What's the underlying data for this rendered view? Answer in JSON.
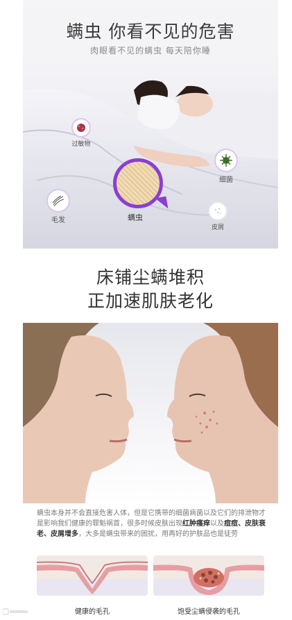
{
  "panel1": {
    "title": "螨虫 你看不见的危害",
    "subtitle": "肉眼看不见的螨虫 每天陪你睡",
    "callouts": {
      "allergen": "过敏物",
      "bacteria": "细菌",
      "hair": "毛发",
      "dandruff": "皮屑",
      "mite": "螨虫"
    }
  },
  "panel2": {
    "title_line1": "床铺尘螨堆积",
    "title_line2": "正加速肌肤老化",
    "paragraph": {
      "p1": "螨虫本身并不会直接危害人体，但是它携带的细菌病菌以及它们的排泄物才是影响我们健康的罪魁祸首，很多时候皮肤出现",
      "h1": "红肿瘙痒",
      "p2": "以及",
      "h2": "痘痘、皮肤衰老、皮屑增多",
      "p3": "，大多是螨虫带来的困扰，用再好的护肤品也是徒劳"
    },
    "pore_healthy_label": "健康的毛孔",
    "pore_mite_label": "饱受尘螨侵袭的毛孔"
  },
  "colors": {
    "accent_purple": "#8a3fd1",
    "highlight_text": "#333333"
  }
}
